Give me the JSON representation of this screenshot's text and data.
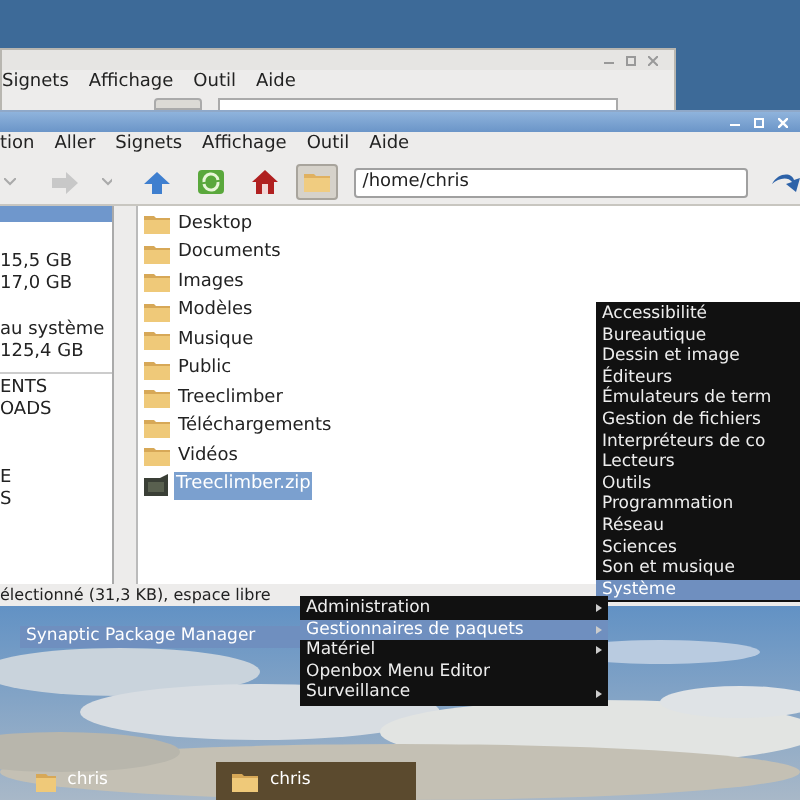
{
  "back_window": {
    "menu": [
      "Signets",
      "Affichage",
      "Outil",
      "Aide"
    ]
  },
  "file_manager": {
    "menu": [
      "tion",
      "Aller",
      "Signets",
      "Affichage",
      "Outil",
      "Aide"
    ],
    "path": "/home/chris",
    "sidebar": {
      "devices": [
        "15,5 GB",
        "17,0 GB",
        "au système",
        "125,4 GB"
      ],
      "places_top": [
        "ENTS",
        "OADS"
      ],
      "places_bottom": [
        "E",
        "S"
      ]
    },
    "files": [
      {
        "name": "Desktop",
        "kind": "folder",
        "selected": false
      },
      {
        "name": "Documents",
        "kind": "folder",
        "selected": false
      },
      {
        "name": "Images",
        "kind": "folder",
        "selected": false
      },
      {
        "name": "Modèles",
        "kind": "folder",
        "selected": false
      },
      {
        "name": "Musique",
        "kind": "folder",
        "selected": false
      },
      {
        "name": "Public",
        "kind": "folder",
        "selected": false
      },
      {
        "name": "Treeclimber",
        "kind": "folder",
        "selected": false
      },
      {
        "name": "Téléchargements",
        "kind": "folder",
        "selected": false
      },
      {
        "name": "Vidéos",
        "kind": "folder",
        "selected": false
      },
      {
        "name": "Treeclimber.zip",
        "kind": "archive",
        "selected": true
      }
    ],
    "status_bar": "électionné (31,3 KB), espace libre"
  },
  "category_menu": [
    {
      "label": "Accessibilité",
      "selected": false
    },
    {
      "label": "Bureautique",
      "selected": false
    },
    {
      "label": "Dessin et image",
      "selected": false
    },
    {
      "label": "Éditeurs",
      "selected": false
    },
    {
      "label": "Émulateurs de term",
      "selected": false
    },
    {
      "label": "Gestion de fichiers",
      "selected": false
    },
    {
      "label": "Interpréteurs de co",
      "selected": false
    },
    {
      "label": "Lecteurs",
      "selected": false
    },
    {
      "label": "Outils",
      "selected": false
    },
    {
      "label": "Programmation",
      "selected": false
    },
    {
      "label": "Réseau",
      "selected": false
    },
    {
      "label": "Sciences",
      "selected": false
    },
    {
      "label": "Son et musique",
      "selected": false
    },
    {
      "label": "Système",
      "selected": true
    }
  ],
  "system_menu": [
    {
      "label": "Administration",
      "selected": false,
      "submenu": true
    },
    {
      "label": "Gestionnaires de paquets",
      "selected": true,
      "submenu": true
    },
    {
      "label": "Matériel",
      "selected": false,
      "submenu": true
    },
    {
      "label": "Openbox Menu Editor",
      "selected": false,
      "submenu": false
    },
    {
      "label": "Surveillance",
      "selected": false,
      "submenu": true
    }
  ],
  "package_menu": [
    {
      "label": "Synaptic Package Manager",
      "selected": true
    }
  ],
  "taskbar": [
    {
      "label": "chris",
      "active": false
    },
    {
      "label": "chris",
      "active": true
    }
  ]
}
